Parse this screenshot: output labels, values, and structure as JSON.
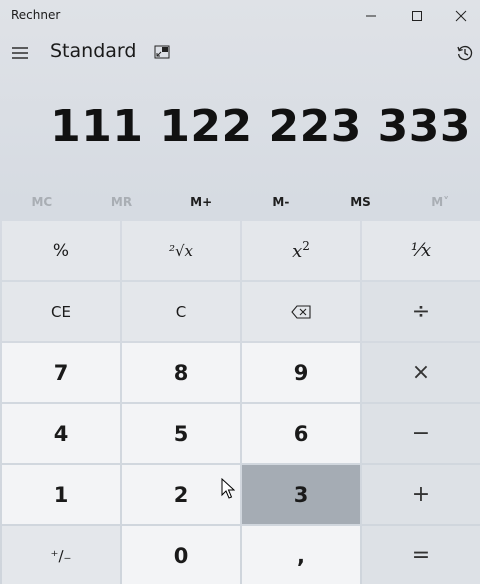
{
  "window": {
    "title": "Rechner",
    "controls": {
      "minimize_icon": "minimize-icon",
      "maximize_icon": "maximize-icon",
      "close_icon": "close-icon"
    }
  },
  "header": {
    "mode": "Standard",
    "menu_icon": "hamburger-icon",
    "keep_on_top_icon": "keep-on-top-icon",
    "history_icon": "history-icon"
  },
  "display": {
    "value": "111 122 223 333"
  },
  "memory": [
    {
      "label": "MC",
      "enabled": false
    },
    {
      "label": "MR",
      "enabled": false
    },
    {
      "label": "M+",
      "enabled": true
    },
    {
      "label": "M-",
      "enabled": true
    },
    {
      "label": "MS",
      "enabled": true
    },
    {
      "label": "M˅",
      "enabled": false
    }
  ],
  "keys": {
    "percent": "%",
    "sqrt": "²√x",
    "square_base": "x",
    "square_exp": "2",
    "reciprocal": "¹⁄x",
    "ce": "CE",
    "c": "C",
    "backspace_icon": "backspace-icon",
    "divide": "÷",
    "seven": "7",
    "eight": "8",
    "nine": "9",
    "multiply": "×",
    "four": "4",
    "five": "5",
    "six": "6",
    "minus": "−",
    "one": "1",
    "two": "2",
    "three": "3",
    "plus": "+",
    "negate": "⁺∕₋",
    "zero": "0",
    "decimal": ",",
    "equals": "="
  },
  "colors": {
    "pressed_key": "#a5acb4",
    "number_key": "#f3f4f6",
    "function_key": "#e4e7eb"
  }
}
